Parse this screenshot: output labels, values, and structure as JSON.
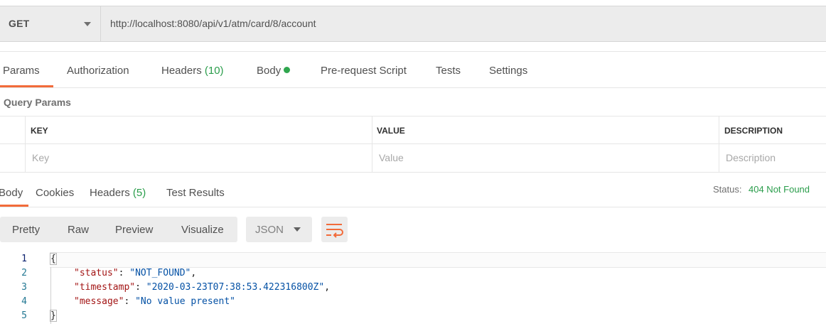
{
  "request": {
    "method": "GET",
    "url": "http://localhost:8080/api/v1/atm/card/8/account"
  },
  "request_tabs": {
    "params": "Params",
    "authorization": "Authorization",
    "headers": "Headers",
    "headers_count": "(10)",
    "body": "Body",
    "pre_request": "Pre-request Script",
    "tests": "Tests",
    "settings": "Settings"
  },
  "query_params": {
    "title": "Query Params",
    "headers": {
      "key": "KEY",
      "value": "VALUE",
      "description": "DESCRIPTION"
    },
    "placeholders": {
      "key": "Key",
      "value": "Value",
      "description": "Description"
    }
  },
  "response_tabs": {
    "body": "Body",
    "cookies": "Cookies",
    "headers": "Headers",
    "headers_count": "(5)",
    "test_results": "Test Results"
  },
  "status": {
    "label": "Status:",
    "value": "404 Not Found"
  },
  "view": {
    "pretty": "Pretty",
    "raw": "Raw",
    "preview": "Preview",
    "visualize": "Visualize",
    "format": "JSON"
  },
  "code": {
    "line_numbers": [
      "1",
      "2",
      "3",
      "4",
      "5"
    ],
    "open_brace": "{",
    "close_brace": "}",
    "status_key": "\"status\"",
    "status_val": "\"NOT_FOUND\"",
    "timestamp_key": "\"timestamp\"",
    "timestamp_val": "\"2020-03-23T07:38:53.422316800Z\"",
    "message_key": "\"message\"",
    "message_val": "\"No value present\"",
    "colon": ": ",
    "comma": ","
  },
  "colors": {
    "accent": "#f26b3a",
    "success": "#2a9d4b"
  },
  "icons": {
    "wrap": "wrap-lines-icon",
    "method_dropdown": "chevron-down-icon"
  }
}
